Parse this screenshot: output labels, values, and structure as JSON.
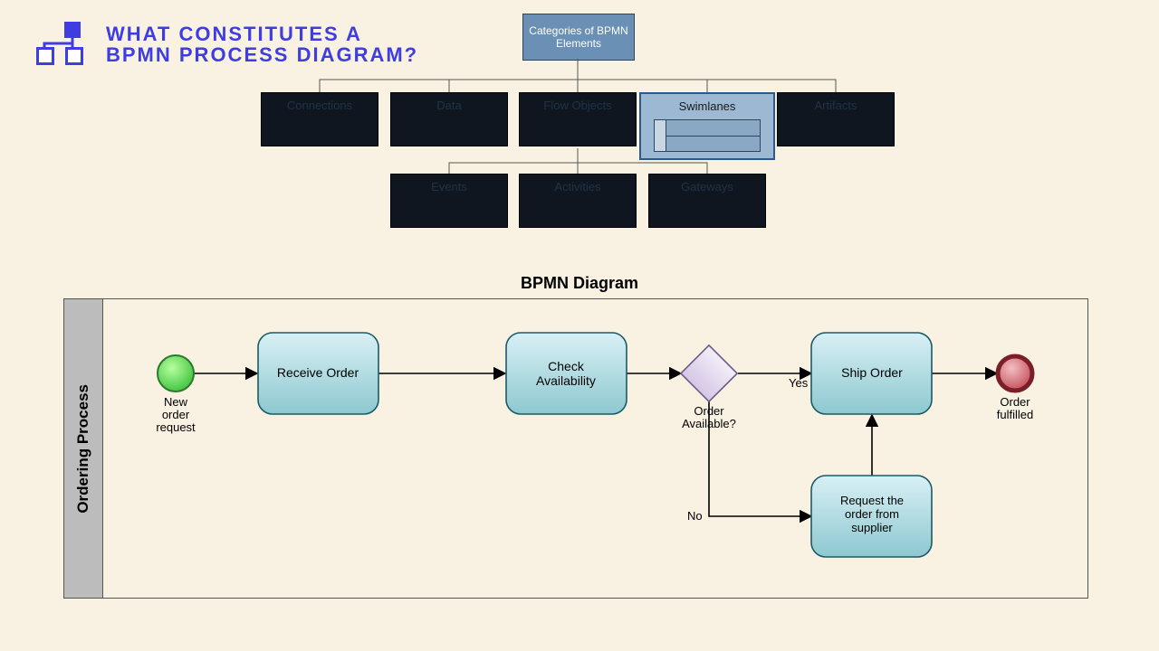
{
  "title_line1": "WHAT CONSTITUTES A",
  "title_line2": "BPMN PROCESS DIAGRAM?",
  "root": "Categories of BPMN Elements",
  "categories": {
    "connections": "Connections",
    "data": "Data",
    "flow_objects": "Flow Objects",
    "swimlanes": "Swimlanes",
    "artifacts": "Artifacts",
    "events": "Events",
    "activities": "Activities",
    "gateways": "Gateways"
  },
  "diagram_title": "BPMN Diagram",
  "pool_label": "Ordering Process",
  "nodes": {
    "start": "New order request",
    "receive": "Receive Order",
    "check": "Check Availability",
    "gateway": "Order Available?",
    "yes": "Yes",
    "no": "No",
    "ship": "Ship Order",
    "request_supplier": "Request the order from supplier",
    "end": "Order fulfilled"
  },
  "chart_data": {
    "type": "bpmn-process",
    "pool": "Ordering Process",
    "elements": [
      {
        "id": "start",
        "type": "startEvent",
        "label": "New order request"
      },
      {
        "id": "receive",
        "type": "task",
        "label": "Receive Order"
      },
      {
        "id": "check",
        "type": "task",
        "label": "Check Availability"
      },
      {
        "id": "gw",
        "type": "exclusiveGateway",
        "label": "Order Available?"
      },
      {
        "id": "ship",
        "type": "task",
        "label": "Ship Order"
      },
      {
        "id": "reqsup",
        "type": "task",
        "label": "Request the order from supplier"
      },
      {
        "id": "end",
        "type": "endEvent",
        "label": "Order fulfilled"
      }
    ],
    "flows": [
      {
        "from": "start",
        "to": "receive"
      },
      {
        "from": "receive",
        "to": "check"
      },
      {
        "from": "check",
        "to": "gw"
      },
      {
        "from": "gw",
        "to": "ship",
        "label": "Yes"
      },
      {
        "from": "gw",
        "to": "reqsup",
        "label": "No"
      },
      {
        "from": "reqsup",
        "to": "ship"
      },
      {
        "from": "ship",
        "to": "end"
      }
    ]
  }
}
